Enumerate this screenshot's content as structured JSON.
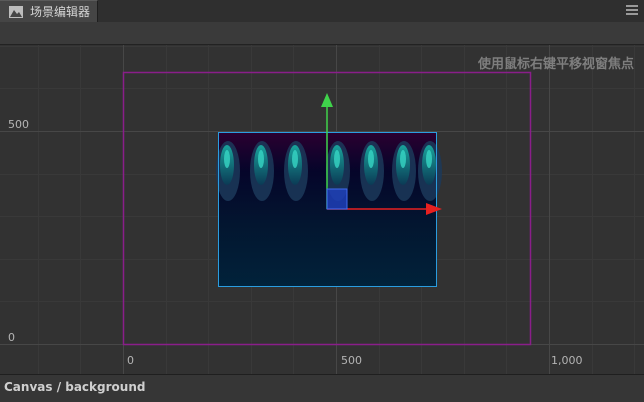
{
  "panel": {
    "tab_title": "场景编辑器",
    "tab_icon": "scene-icon",
    "menu_icon": "menu-icon"
  },
  "viewport": {
    "hint": "使用鼠标右键平移视窗焦点",
    "y_labels": [
      "500",
      "0"
    ],
    "x_labels": [
      "0",
      "500",
      "1,000"
    ],
    "canvas_outline_color": "#8a1e8a",
    "selection_outline_color": "#2a9de0",
    "gizmo": {
      "y_axis_color": "#3fd34b",
      "x_axis_color": "#e82020",
      "handle_color": "#1f3fb8"
    }
  },
  "status": {
    "path": "Canvas / background"
  }
}
